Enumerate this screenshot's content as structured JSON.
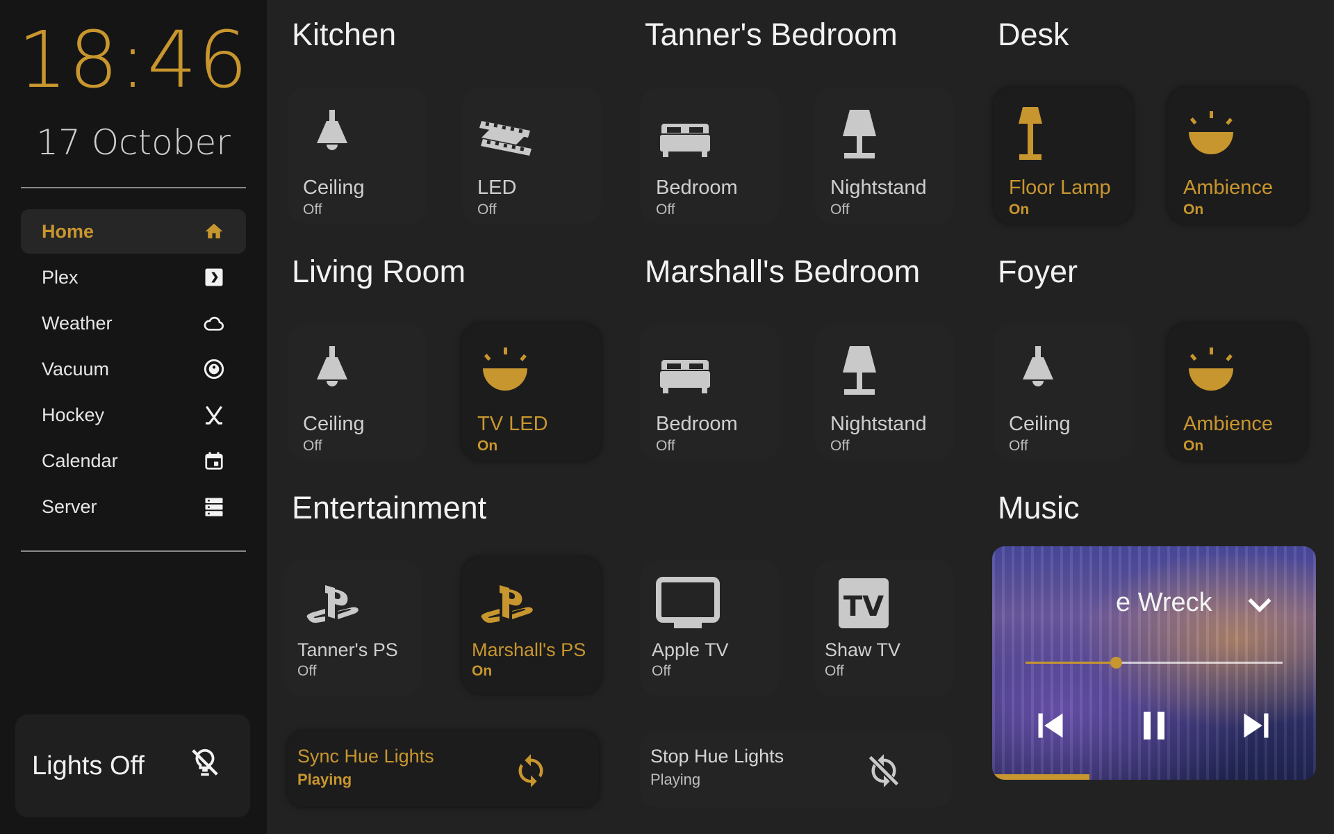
{
  "colors": {
    "accent": "#c8962e",
    "sidebar_bg": "#151515",
    "main_bg": "#222222"
  },
  "sidebar": {
    "time": "18:46",
    "date": "17 October",
    "nav": [
      {
        "label": "Home",
        "icon": "home-icon",
        "active": true
      },
      {
        "label": "Plex",
        "icon": "plex-icon"
      },
      {
        "label": "Weather",
        "icon": "cloud-icon"
      },
      {
        "label": "Vacuum",
        "icon": "robot-vacuum-icon"
      },
      {
        "label": "Hockey",
        "icon": "hockey-sticks-icon"
      },
      {
        "label": "Calendar",
        "icon": "calendar-icon"
      },
      {
        "label": "Server",
        "icon": "server-icon"
      }
    ],
    "lights_off": {
      "label": "Lights Off",
      "icon": "lightbulb-off-icon"
    }
  },
  "sections": {
    "kitchen": {
      "title": "Kitchen",
      "devices": [
        {
          "name": "Ceiling",
          "state": "Off",
          "icon": "ceiling-light-icon"
        },
        {
          "name": "LED",
          "state": "Off",
          "icon": "led-strip-icon"
        }
      ]
    },
    "tanners_bedroom": {
      "title": "Tanner's Bedroom",
      "devices": [
        {
          "name": "Bedroom",
          "state": "Off",
          "icon": "bed-icon"
        },
        {
          "name": "Nightstand",
          "state": "Off",
          "icon": "table-lamp-icon"
        }
      ]
    },
    "desk": {
      "title": "Desk",
      "devices": [
        {
          "name": "Floor Lamp",
          "state": "On",
          "icon": "floor-lamp-icon"
        },
        {
          "name": "Ambience",
          "state": "On",
          "icon": "ambience-bowl-icon"
        }
      ]
    },
    "living_room": {
      "title": "Living Room",
      "devices": [
        {
          "name": "Ceiling",
          "state": "Off",
          "icon": "ceiling-light-icon"
        },
        {
          "name": "TV LED",
          "state": "On",
          "icon": "ambience-bowl-icon"
        }
      ]
    },
    "marshalls_bedroom": {
      "title": "Marshall's Bedroom",
      "devices": [
        {
          "name": "Bedroom",
          "state": "Off",
          "icon": "bed-icon"
        },
        {
          "name": "Nightstand",
          "state": "Off",
          "icon": "table-lamp-icon"
        }
      ]
    },
    "foyer": {
      "title": "Foyer",
      "devices": [
        {
          "name": "Ceiling",
          "state": "Off",
          "icon": "ceiling-light-icon"
        },
        {
          "name": "Ambience",
          "state": "On",
          "icon": "ambience-bowl-icon"
        }
      ]
    },
    "entertainment": {
      "title": "Entertainment",
      "devices": [
        {
          "name": "Tanner's PS",
          "state": "Off",
          "icon": "playstation-icon"
        },
        {
          "name": "Marshall's PS",
          "state": "On",
          "icon": "playstation-icon"
        },
        {
          "name": "Apple TV",
          "state": "Off",
          "icon": "television-icon"
        },
        {
          "name": "Shaw TV",
          "state": "Off",
          "icon": "tv-box-icon"
        }
      ],
      "sync": [
        {
          "name": "Sync Hue Lights",
          "state": "Playing",
          "icon": "sync-icon"
        },
        {
          "name": "Stop Hue Lights",
          "state": "Playing",
          "icon": "sync-off-icon"
        }
      ]
    },
    "music": {
      "title": "Music",
      "track": "e Wreck",
      "seek_position": 0.35,
      "progress": 0.3,
      "controls": [
        "previous-icon",
        "pause-icon",
        "next-icon"
      ]
    }
  }
}
